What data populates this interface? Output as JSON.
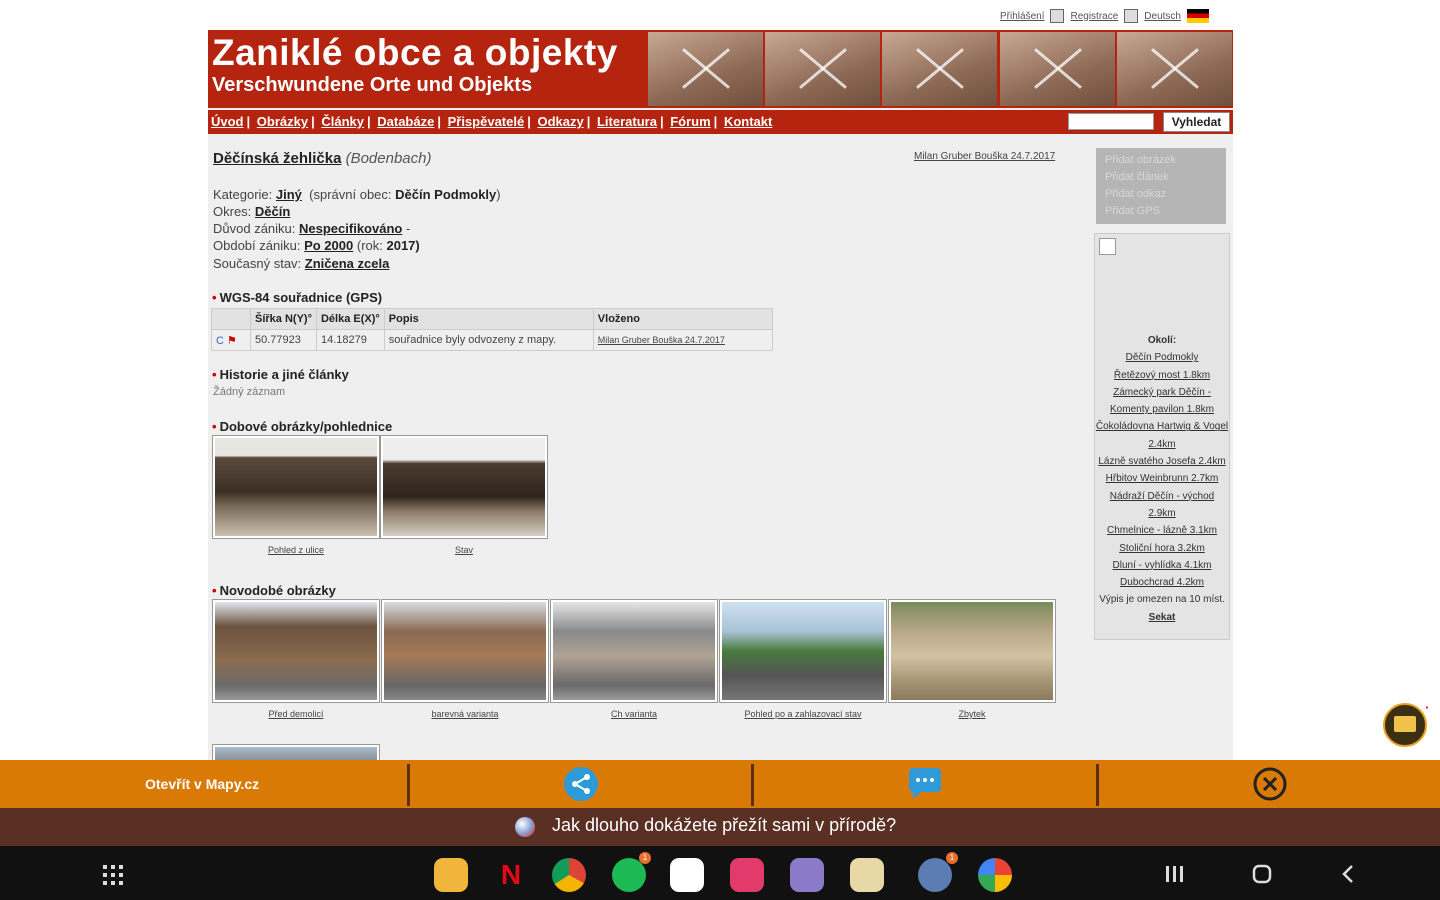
{
  "toplinks": {
    "login": "Přihlášení",
    "register": "Registrace",
    "lang": "Deutsch"
  },
  "banner": {
    "title": "Zaniklé obce a objekty",
    "subtitle": "Verschwundene Orte und Objekts"
  },
  "nav": {
    "items": [
      "Úvod",
      "Obrázky",
      "Články",
      "Databáze",
      "Přispěvatelé",
      "Odkazy",
      "Literatura",
      "Fórum",
      "Kontakt"
    ],
    "search_button": "Vyhledat"
  },
  "object": {
    "name": "Děčínská žehlička",
    "name_de": "(Bodenbach)",
    "author_date": "Milan Gruber Bouška 24.7.2017",
    "category_label": "Kategorie:",
    "category": "Jiný",
    "admin_label": "(správní obec:",
    "admin": "Děčín Podmokly",
    "admin_close": ")",
    "district_label": "Okres:",
    "district": "Děčín",
    "reason_label": "Důvod zániku:",
    "reason": "Nespecifikováno",
    "reason_suffix": "-",
    "period_label": "Období zániku:",
    "period": "Po 2000",
    "year_label": "(rok:",
    "year": "2017)",
    "state_label": "Současný stav:",
    "state": "Zničena zcela"
  },
  "actions": [
    "Přidat obrázek",
    "Přidat článek",
    "Přidat odkaz",
    "Přidat GPS"
  ],
  "coords": {
    "heading": "WGS-84 souřadnice (GPS)",
    "headers": [
      "Šířka N(Y)°",
      "Délka E(X)°",
      "Popis",
      "Vloženo"
    ],
    "row": {
      "lat": "50.77923",
      "lon": "14.18279",
      "desc": "souřadnice byly odvozeny z mapy.",
      "added": "Milan Gruber Bouška 24.7.2017"
    }
  },
  "history": {
    "heading": "Historie a jiné články",
    "empty": "Žádný záznam"
  },
  "period_images": {
    "heading": "Dobové obrázky/pohlednice",
    "captions": [
      "Pohled z ulice",
      "Stav"
    ]
  },
  "modern_images": {
    "heading": "Novodobé obrázky",
    "captions": [
      "Před demolicí",
      "barevná varianta",
      "Ch varianta",
      "Pohled po a zahlazovací stav",
      "Zbytek"
    ]
  },
  "nearby": {
    "heading": "Okolí:",
    "items": [
      "Děčín Podmokly",
      "Řetězový most 1.8km",
      "Zámecký park Děčín - Komenty pavilon 1.8km",
      "Čokoládovna Hartwig & Vogel 2.4km",
      "Lázně svatého Josefa 2.4km",
      "Hřbitov Weinbrunn 2.7km",
      "Nádraží Děčín - východ 2.9km",
      "Chmelnice - lázně 3.1km",
      "Stoliční hora 3.2km",
      "Dluní - vyhlídka 4.1km",
      "Dubochcrad 4.2km"
    ],
    "limit_note": "Výpis je omezen na 10 míst.",
    "limit_link": "Sekat"
  },
  "appbar": {
    "open_map": "Otevřít v Mapy.cz"
  },
  "ad": {
    "text": "Jak dlouho dokážete přežít sami v přírodě?"
  },
  "colors": {
    "brand": "#b5240f",
    "appbar": "#d97a07",
    "adbar": "#5a2f24"
  }
}
